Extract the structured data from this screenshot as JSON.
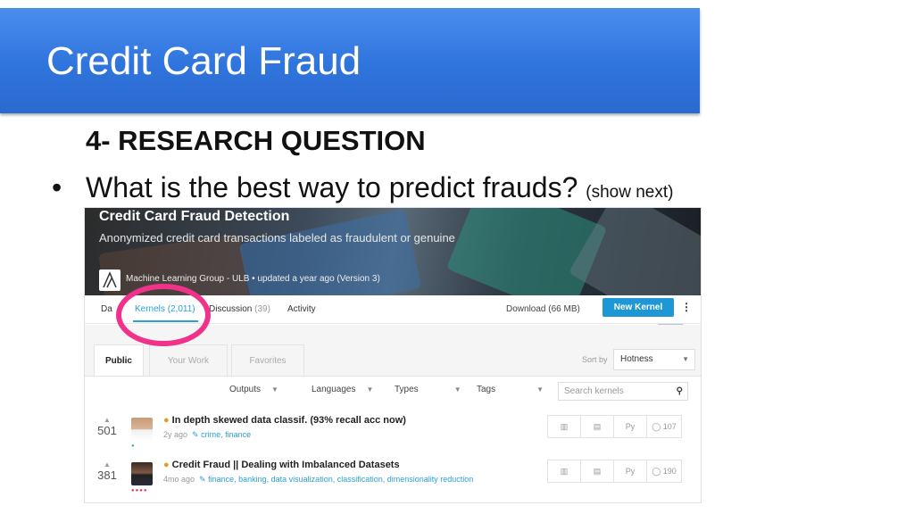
{
  "slide": {
    "title": "Credit Card Fraud",
    "heading": "4- RESEARCH QUESTION",
    "bullet_symbol": "•",
    "bullet_text": "What is the best way to predict frauds?",
    "bullet_note": "(show next)"
  },
  "dataset": {
    "title": "Credit Card Fraud Detection",
    "subtitle": "Anonymized credit card transactions labeled as fraudulent or genuine",
    "meta": "Machine Learning Group - ULB  •  updated a year ago (Version 3)"
  },
  "tabs": [
    {
      "label": "Da",
      "count": ""
    },
    {
      "label": "Kernels",
      "count": "(2,011)"
    },
    {
      "label": "Discussion",
      "count": "(39)"
    },
    {
      "label": "Activity",
      "count": ""
    }
  ],
  "download_label": "Download (66 MB)",
  "new_kernel_label": "New Kernel",
  "kebab_icon": "⋮",
  "subtabs": [
    "Public",
    "Your Work",
    "Favorites"
  ],
  "sort": {
    "label": "Sort by",
    "value": "Hotness"
  },
  "filters": [
    "Outputs",
    "Languages",
    "Types",
    "Tags"
  ],
  "search_placeholder": "Search kernels",
  "kernels": [
    {
      "votes": "501",
      "title": "In depth skewed data classif. (93% recall acc now)",
      "age": "2y ago",
      "tags": "crime, finance",
      "lang": "Py",
      "comments": "107"
    },
    {
      "votes": "381",
      "title": "Credit Fraud || Dealing with Imbalanced Datasets",
      "age": "4mo ago",
      "tags": "finance, banking, data visualization, classification, dimensionality reduction",
      "lang": "Py",
      "comments": "190"
    }
  ],
  "colors": {
    "title_bar": "#2f74dc",
    "accent": "#2ba0d6",
    "highlight_circle": "#f0328a"
  }
}
